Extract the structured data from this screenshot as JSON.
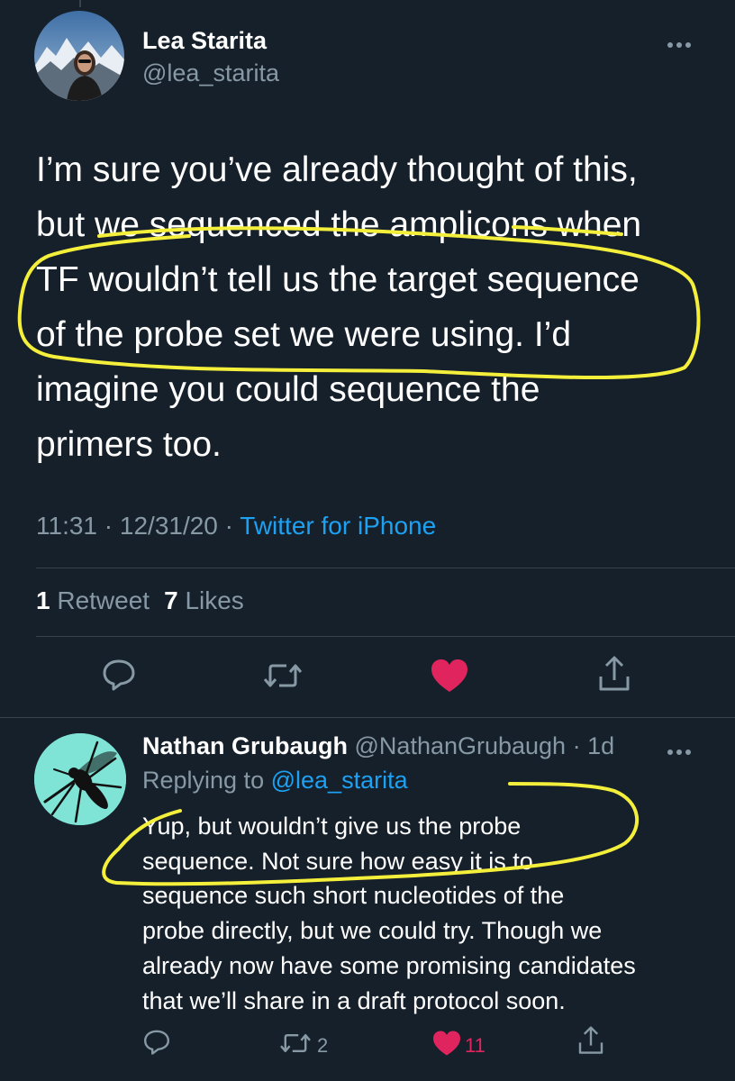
{
  "main_tweet": {
    "author_name": "Lea Starita",
    "author_handle": "@lea_starita",
    "text_lines": [
      "I’m sure you’ve already thought of this,",
      "but we sequenced the amplicons when",
      "TF wouldn’t tell us the target sequence",
      "of the probe set we were using. I’d",
      "imagine you could sequence the",
      "primers too."
    ],
    "time": "11:31",
    "date": "12/31/20",
    "separator": "·",
    "source": "Twitter for iPhone",
    "retweet_count": "1",
    "retweet_label": "Retweet",
    "like_count": "7",
    "like_label": "Likes"
  },
  "reply_tweet": {
    "author_name": "Nathan Grubaugh",
    "author_handle": "@NathanGrubaugh",
    "time_ago": "1d",
    "replying_to_label": "Replying to",
    "replying_to_handle": "@lea_starita",
    "text_lines": [
      "Yup, but wouldn’t give us the probe",
      "sequence. Not sure how easy it is to",
      "sequence such short nucleotides of the",
      "probe directly, but we could try. Though we",
      "already now have some promising candidates",
      "that we’ll share in a draft protocol soon."
    ],
    "retweet_count": "2",
    "like_count": "11"
  },
  "icons": {
    "more": "more-horizontal-icon",
    "reply": "reply-bubble-icon",
    "retweet": "retweet-icon",
    "like": "heart-icon",
    "share": "share-icon"
  },
  "colors": {
    "background": "#15202b",
    "text": "#ffffff",
    "secondary": "#8899a6",
    "link": "#1da1f2",
    "like": "#e0245e",
    "divider": "#38444d",
    "highlighter": "#f4ef3b"
  }
}
